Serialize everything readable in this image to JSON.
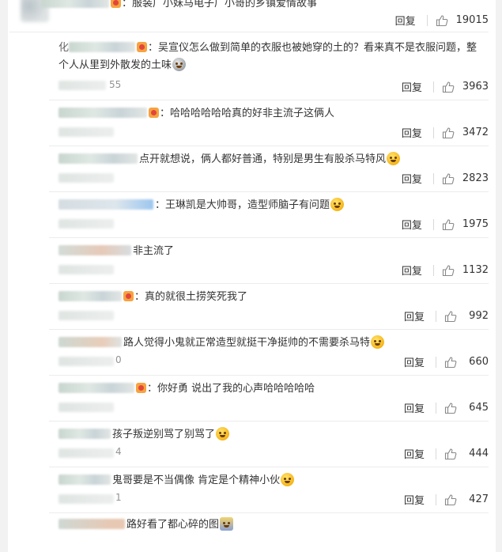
{
  "comments": [
    {
      "name": "",
      "text": "：服装广小妹马电子厂小哥的乡镇爱情故事",
      "emoji": "",
      "time_tail": "",
      "reply": "回复",
      "likes": "19015"
    },
    {
      "name": "化",
      "text": "：吴宣仪怎么做到简单的衣服也被她穿的土的？看来真不是衣服问题，整个人从里到外散发的土味",
      "emoji": "grey-face-emoji",
      "time_tail": "55",
      "reply": "回复",
      "likes": "3963"
    },
    {
      "name": "",
      "text": "：哈哈哈哈哈哈真的好非主流子这俩人",
      "emoji": "",
      "time_tail": "",
      "reply": "回复",
      "likes": "3472"
    },
    {
      "name": "",
      "text": "点开就想说，俩人都好普通，特别是男生有股杀马特风",
      "emoji": "laugh-cry-emoji",
      "time_tail": "",
      "reply": "回复",
      "likes": "2823"
    },
    {
      "name": "",
      "text": "：王琳凯是大帅哥，造型师脑子有问题",
      "emoji": "scared-face-emoji",
      "time_tail": "",
      "reply": "回复",
      "likes": "1975"
    },
    {
      "name": "",
      "text": "非主流了",
      "emoji": "",
      "time_tail": "",
      "reply": "回复",
      "likes": "1132"
    },
    {
      "name": "",
      "text": "：真的就很土捞笑死我了",
      "emoji": "",
      "time_tail": "",
      "reply": "回复",
      "likes": "992"
    },
    {
      "name": "",
      "text": "路人觉得小鬼就正常造型就挺干净挺帅的不需要杀马特",
      "emoji": "laugh-cry-emoji",
      "time_tail": "0",
      "reply": "回复",
      "likes": "660"
    },
    {
      "name": "",
      "text": "：你好勇 说出了我的心声哈哈哈哈哈",
      "emoji": "",
      "time_tail": "",
      "reply": "回复",
      "likes": "645"
    },
    {
      "name": "",
      "text": "孩子叛逆别骂了别骂了",
      "emoji": "laugh-cry-emoji",
      "time_tail": "4",
      "reply": "回复",
      "likes": "444"
    },
    {
      "name": "",
      "text": "鬼哥要是不当偶像 肯定是个精神小伙",
      "emoji": "doge-emoji",
      "time_tail": "1",
      "reply": "回复",
      "likes": "427"
    },
    {
      "name": "",
      "text": "路好看了都心碎的图",
      "emoji": "figure-emoji",
      "time_tail": "",
      "reply": "",
      "likes": ""
    }
  ]
}
